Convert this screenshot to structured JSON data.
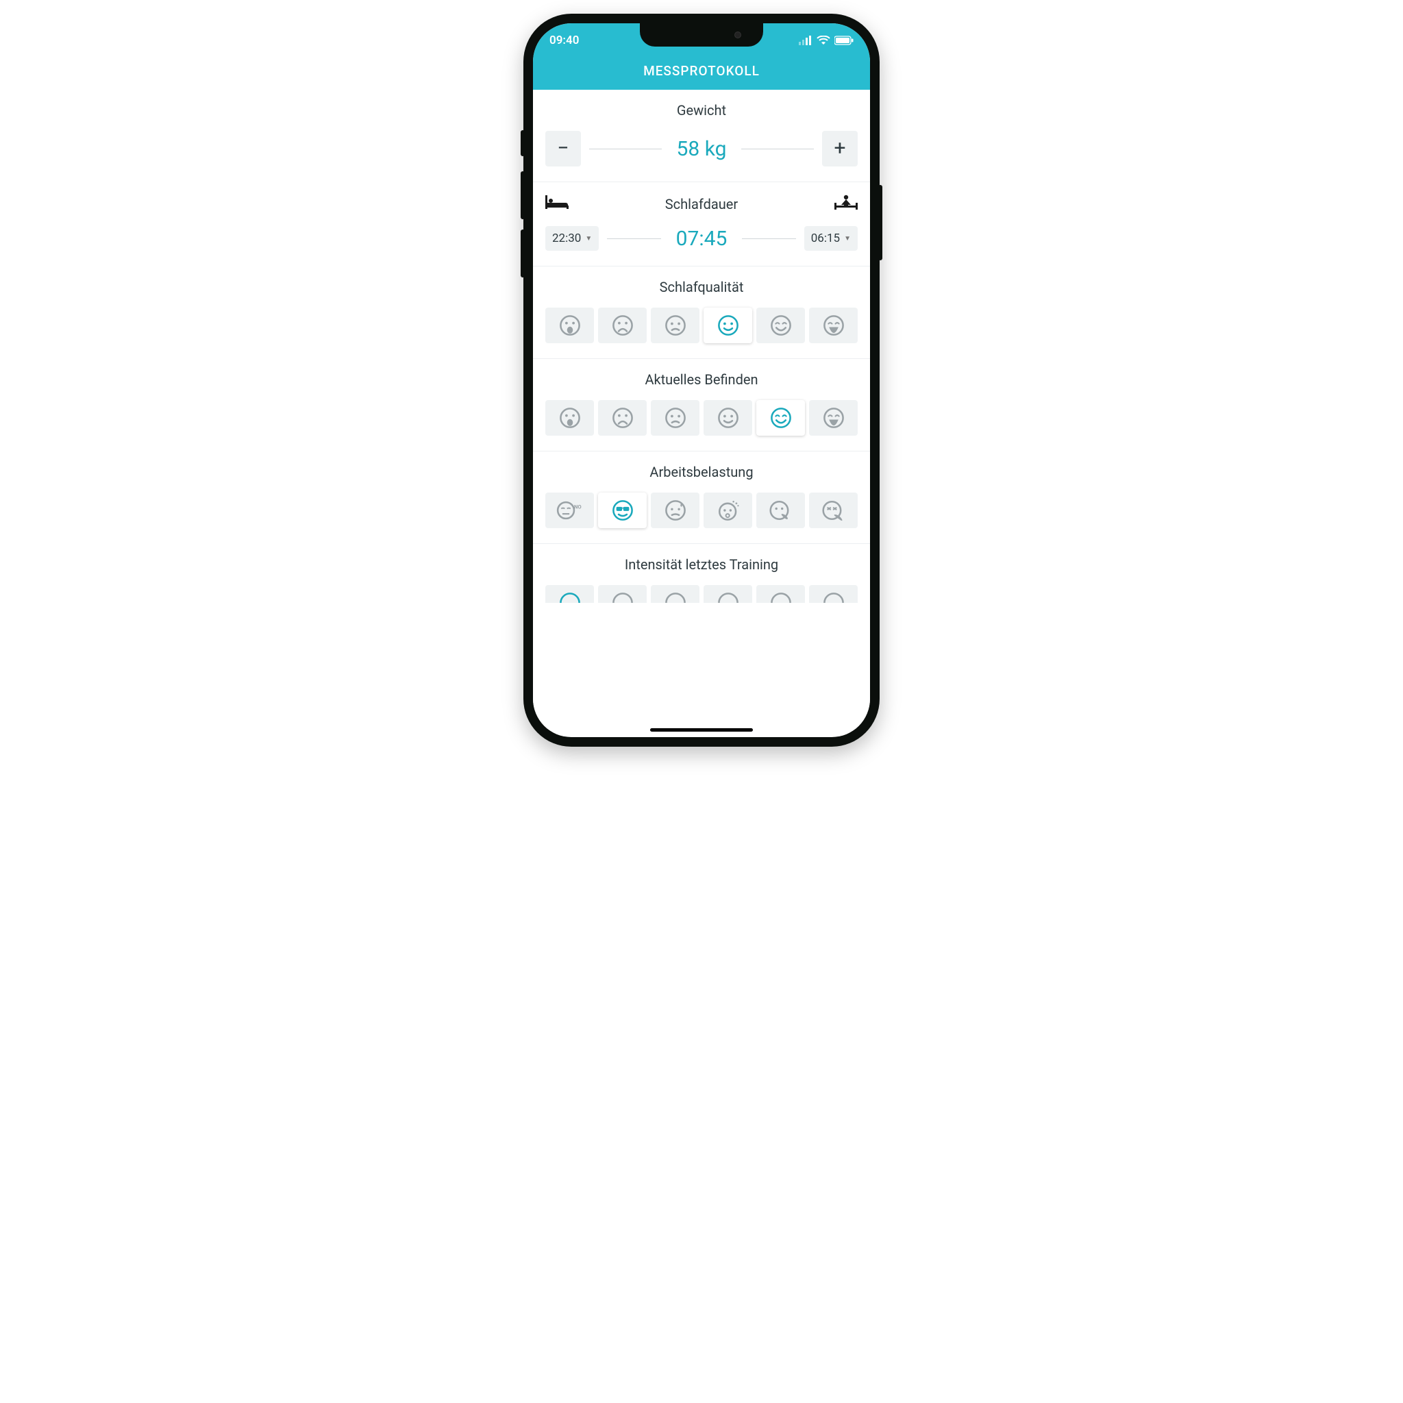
{
  "status": {
    "time": "09:40"
  },
  "title": "MESSPROTOKOLL",
  "weight": {
    "label": "Gewicht",
    "value": "58 kg",
    "minus": "−",
    "plus": "+"
  },
  "sleep": {
    "label": "Schlafdauer",
    "bedtime": "22:30",
    "waketime": "06:15",
    "duration": "07:45"
  },
  "quality": {
    "label": "Schlafqualität",
    "selected_index": 3
  },
  "mood": {
    "label": "Aktuelles Befinden",
    "selected_index": 4
  },
  "workload": {
    "label": "Arbeitsbelastung",
    "selected_index": 1
  },
  "intensity": {
    "label": "Intensität letztes Training"
  },
  "colors": {
    "accent": "#28bcd0",
    "value": "#1aa9bc",
    "chip": "#eff2f3",
    "face_gray": "#9aa2a6"
  }
}
